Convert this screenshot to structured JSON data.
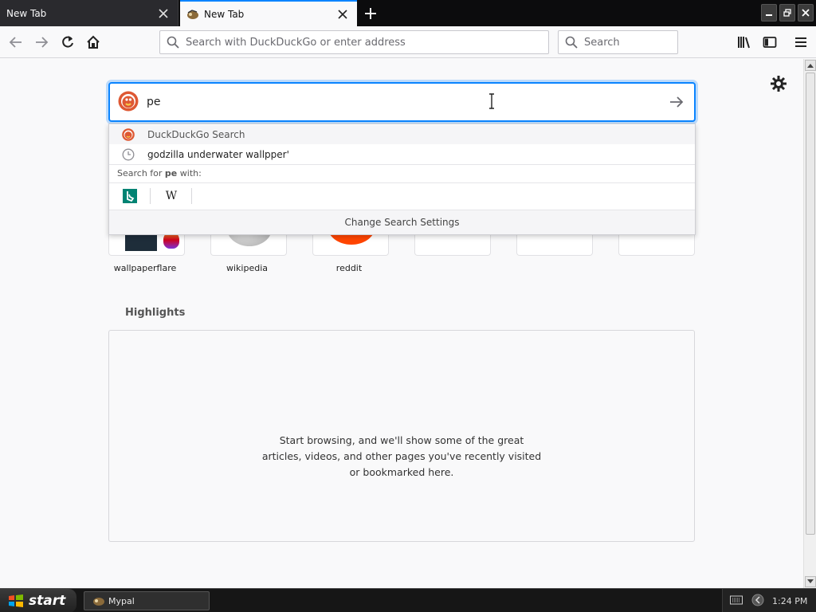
{
  "tabs": [
    {
      "label": "New Tab",
      "active": false
    },
    {
      "label": "New Tab",
      "active": true
    }
  ],
  "toolbar": {
    "url_placeholder": "Search with DuckDuckGo or enter address",
    "search_placeholder": "Search"
  },
  "newtab": {
    "search_value": "pe",
    "dropdown": {
      "engine_row": "DuckDuckGo Search",
      "history_row": "godzilla underwater wallpper'",
      "search_for_prefix": "Search for ",
      "search_for_term": "pe",
      "search_for_suffix": " with:",
      "engines": [
        {
          "name": "bing-icon"
        },
        {
          "name": "wikipedia-icon",
          "glyph": "W"
        }
      ],
      "change_settings": "Change Search Settings"
    },
    "top_sites": [
      {
        "label": "wallpaperflare"
      },
      {
        "label": "wikipedia"
      },
      {
        "label": "reddit"
      },
      {
        "label": ""
      },
      {
        "label": ""
      },
      {
        "label": ""
      }
    ],
    "highlights": {
      "title": "Highlights",
      "message": "Start browsing, and we'll show some of the great articles, videos, and other pages you've recently visited or bookmarked here."
    }
  },
  "taskbar": {
    "start_label": "start",
    "task_label": "Mypal",
    "clock": "1:24 PM"
  },
  "colors": {
    "accent": "#0a84ff",
    "duckduckgo": "#de5833",
    "bing": "#008373",
    "reddit": "#ff4500"
  }
}
